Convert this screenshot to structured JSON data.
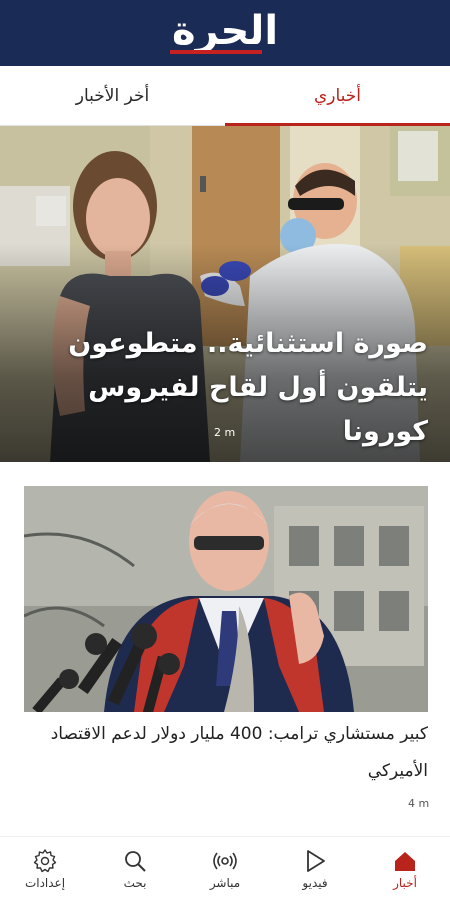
{
  "header": {
    "logo_text": "الحرة"
  },
  "tabs": [
    {
      "label": "أخباري",
      "active": true
    },
    {
      "label": "أخر الأخبار",
      "active": false
    }
  ],
  "hero": {
    "title_line1": "صورة استثنائية.. متطوعون",
    "title_line2": "يتلقون أول لقاح لفيروس كورونا",
    "time": "2 m"
  },
  "card": {
    "title": "كبير مستشاري ترامب: 400 مليار دولار لدعم الاقتصاد الأميركي",
    "time": "4 m"
  },
  "bottom_nav": [
    {
      "label": "أخبار",
      "icon": "home-icon",
      "active": true
    },
    {
      "label": "فيديو",
      "icon": "play-icon",
      "active": false
    },
    {
      "label": "مباشر",
      "icon": "live-icon",
      "active": false
    },
    {
      "label": "بحث",
      "icon": "search-icon",
      "active": false
    },
    {
      "label": "إعدادات",
      "icon": "gear-icon",
      "active": false
    }
  ],
  "colors": {
    "brand": "#1a2b55",
    "accent": "#b8241c"
  }
}
